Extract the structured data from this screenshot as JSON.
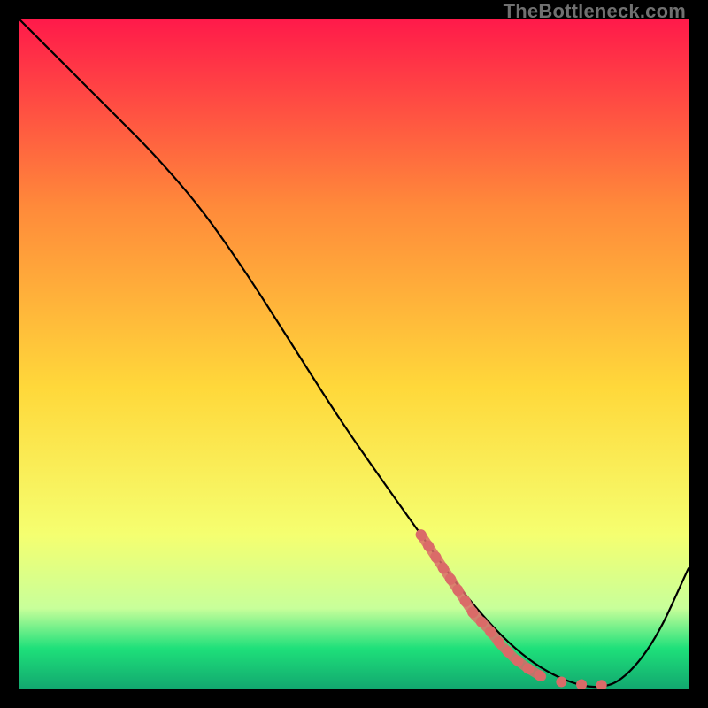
{
  "watermark": "TheBottleneck.com",
  "colors": {
    "frame": "#000000",
    "curve": "#000000",
    "marker": "#d96b68",
    "gradient_top": "#ff1a4a",
    "gradient_mid_upper": "#ff8a3a",
    "gradient_mid": "#ffd83a",
    "gradient_mid_lower": "#f5ff70",
    "gradient_light": "#c8ff9a",
    "gradient_green": "#1ee07a",
    "gradient_bottom": "#12a86f"
  },
  "chart_data": {
    "type": "line",
    "title": "",
    "xlabel": "",
    "ylabel": "",
    "xlim": [
      0,
      100
    ],
    "ylim": [
      0,
      100
    ],
    "series": [
      {
        "name": "bottleneck-curve",
        "x": [
          0,
          7,
          14,
          20,
          27,
          34,
          41,
          48,
          55,
          60,
          65,
          70,
          74,
          78,
          82,
          86,
          90,
          95,
          100
        ],
        "values": [
          100,
          93,
          86,
          80,
          72,
          62,
          51,
          40,
          30,
          23,
          16,
          10,
          6,
          3,
          1,
          0,
          1,
          7,
          18
        ]
      }
    ],
    "markers": {
      "name": "highlight-band",
      "points": [
        {
          "x": 60,
          "y": 23
        },
        {
          "x": 62,
          "y": 20
        },
        {
          "x": 64,
          "y": 17
        },
        {
          "x": 66,
          "y": 14
        },
        {
          "x": 68,
          "y": 11
        },
        {
          "x": 70,
          "y": 9
        },
        {
          "x": 72,
          "y": 6.5
        },
        {
          "x": 74,
          "y": 4.5
        },
        {
          "x": 76,
          "y": 3
        },
        {
          "x": 78,
          "y": 1.8
        },
        {
          "x": 81,
          "y": 1
        },
        {
          "x": 84,
          "y": 0.6
        },
        {
          "x": 87,
          "y": 0.5
        }
      ]
    }
  }
}
